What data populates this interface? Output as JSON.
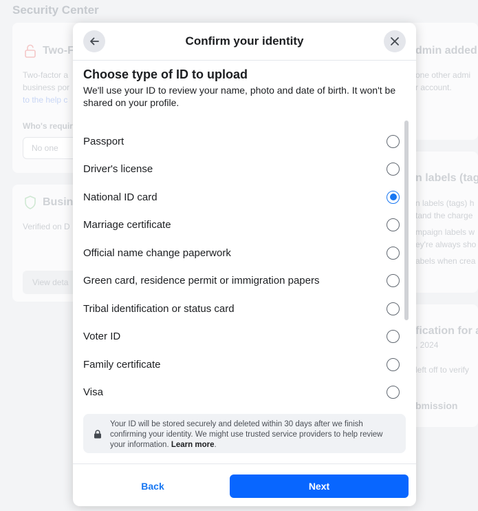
{
  "background": {
    "page_title": "Security Center",
    "card1": {
      "heading": "Two-F",
      "text_lines": [
        "Two-factor a",
        "business por",
        "to the help c"
      ],
      "field_label": "Who's requir",
      "input_value": "No one"
    },
    "card2": {
      "heading": "Busin",
      "text": "Verified on D",
      "button": "View deta"
    },
    "right1": {
      "heading": "dmin added",
      "lines": [
        "one other admi",
        "r account."
      ]
    },
    "right2": {
      "heading": "n labels (tag",
      "lines": [
        "n labels (tags) h",
        "tand the charge",
        "mpaign labels w",
        "ey're always sho",
        "abels when crea"
      ]
    },
    "right3": {
      "heading": "fication for a",
      "lines": [
        ", 2024",
        "left off to verify"
      ]
    },
    "right4": {
      "heading": "bmission"
    }
  },
  "modal": {
    "title": "Confirm your identity",
    "back_icon": "arrow-left-icon",
    "close_icon": "close-icon",
    "section_title": "Choose type of ID to upload",
    "section_desc": "We'll use your ID to review your name, photo and date of birth. It won't be shared on your profile.",
    "options": [
      {
        "label": "Passport",
        "selected": false
      },
      {
        "label": "Driver's license",
        "selected": false
      },
      {
        "label": "National ID card",
        "selected": true
      },
      {
        "label": "Marriage certificate",
        "selected": false
      },
      {
        "label": "Official name change paperwork",
        "selected": false
      },
      {
        "label": "Green card, residence permit or immigration papers",
        "selected": false
      },
      {
        "label": "Tribal identification or status card",
        "selected": false
      },
      {
        "label": "Voter ID",
        "selected": false
      },
      {
        "label": "Family certificate",
        "selected": false
      },
      {
        "label": "Visa",
        "selected": false
      }
    ],
    "notice": {
      "text": "Your ID will be stored securely and deleted within 30 days after we finish confirming your identity. We might use trusted service providers to help review your information.",
      "link": "Learn more",
      "icon": "lock-icon"
    },
    "footer": {
      "back_label": "Back",
      "next_label": "Next"
    },
    "colors": {
      "accent": "#1877f2",
      "primary_button": "#0866ff"
    }
  }
}
